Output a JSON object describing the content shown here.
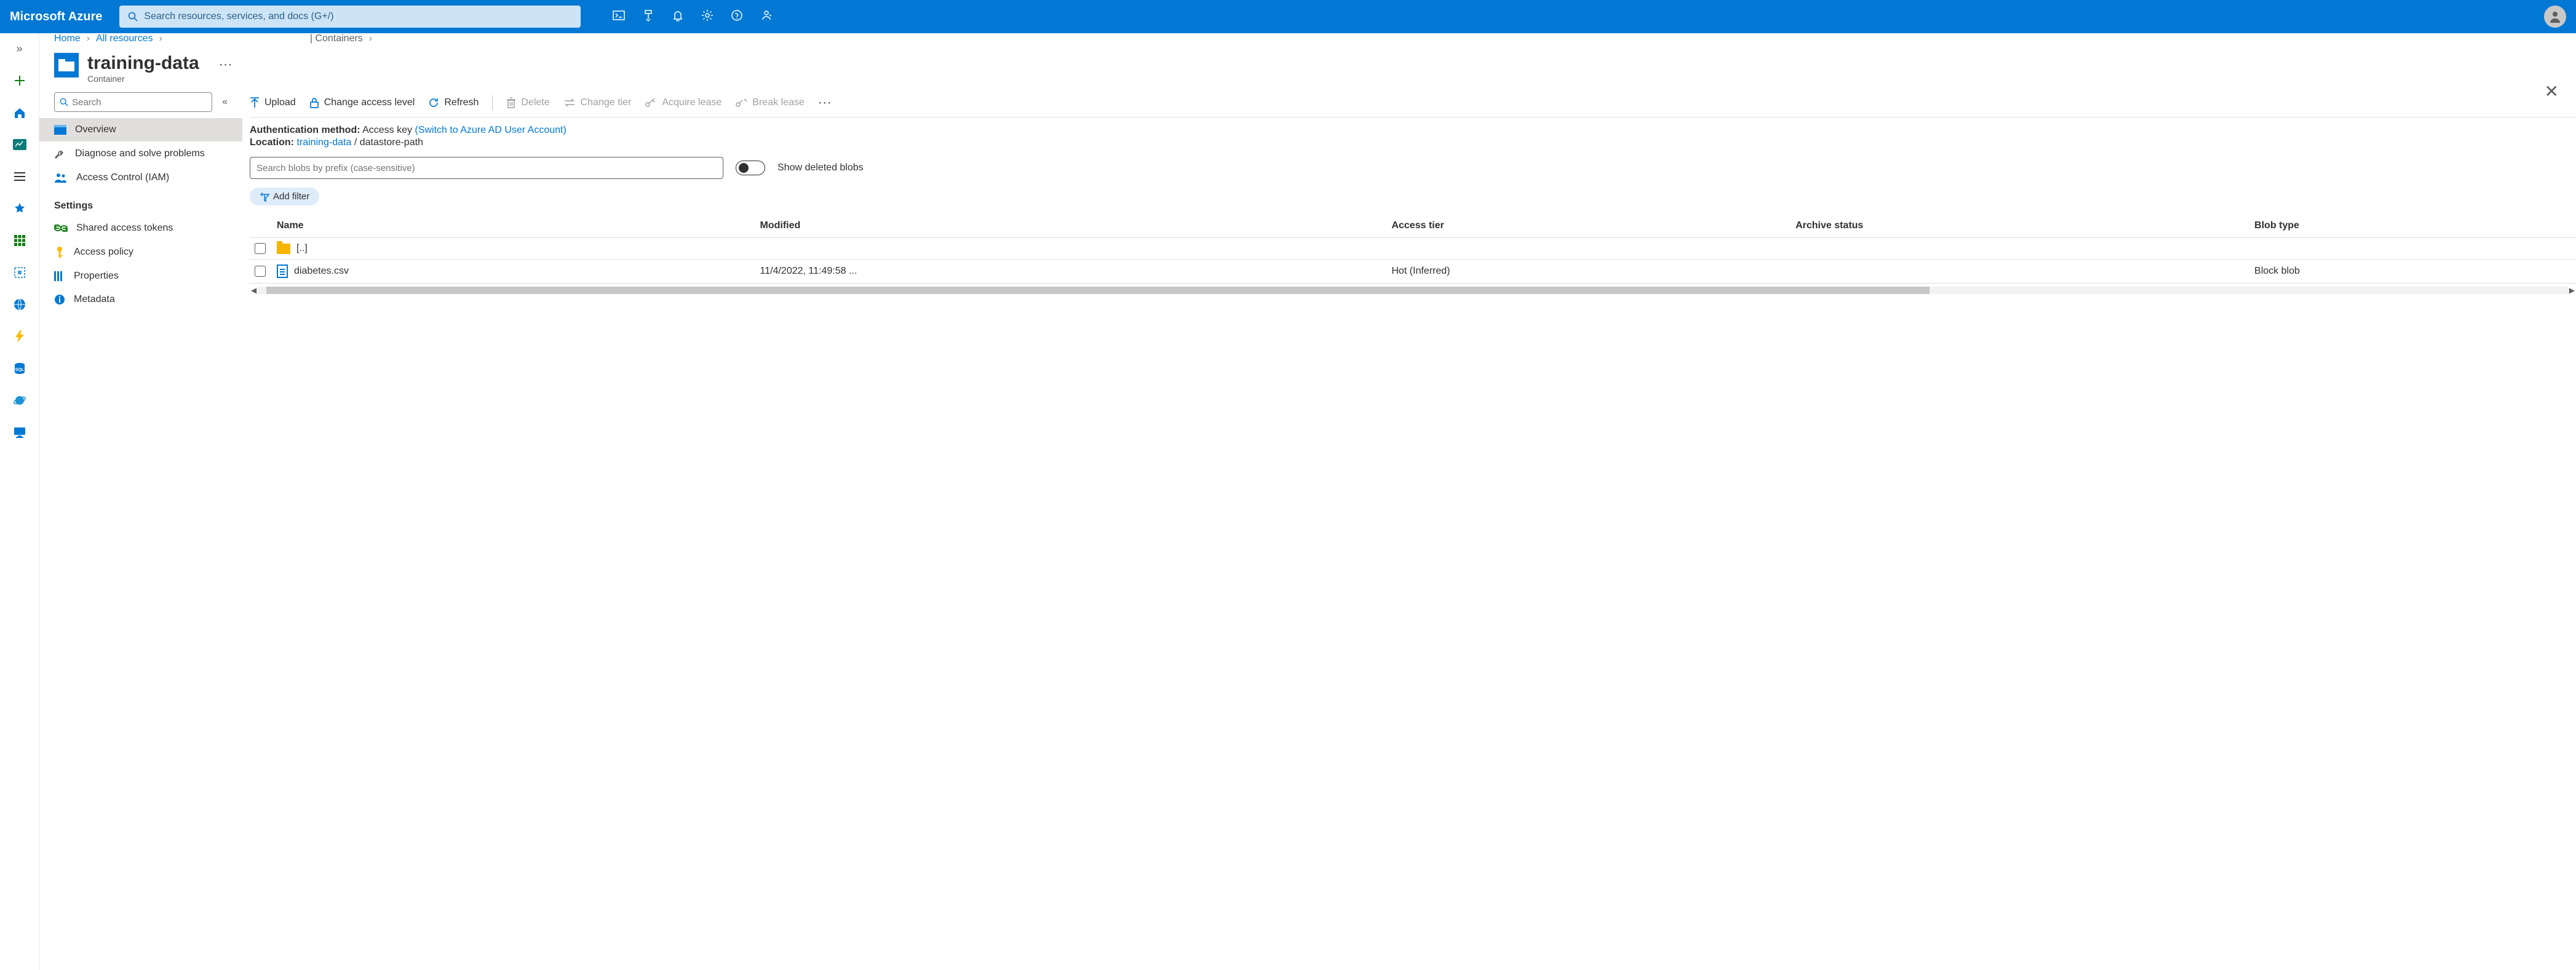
{
  "brand": "Microsoft Azure",
  "topsearch_placeholder": "Search resources, services, and docs (G+/)",
  "breadcrumbs": {
    "home": "Home",
    "all": "All resources",
    "pipe": "| Containers"
  },
  "heading": {
    "title": "training-data",
    "subtitle": "Container"
  },
  "sidesearch_placeholder": "Search",
  "menu": {
    "overview": "Overview",
    "diagnose": "Diagnose and solve problems",
    "iam": "Access Control (IAM)",
    "settings_section": "Settings",
    "sas": "Shared access tokens",
    "policy": "Access policy",
    "props": "Properties",
    "meta": "Metadata"
  },
  "toolbar": {
    "upload": "Upload",
    "cal": "Change access level",
    "refresh": "Refresh",
    "delete": "Delete",
    "tier": "Change tier",
    "acquire": "Acquire lease",
    "break": "Break lease"
  },
  "auth": {
    "method_lbl": "Authentication method:",
    "method_val": "Access key",
    "switch": "(Switch to Azure AD User Account)",
    "loc_lbl": "Location:",
    "loc_link": "training-data",
    "loc_rest": "datastore-path"
  },
  "blobsearch_placeholder": "Search blobs by prefix (case-sensitive)",
  "toggle_label": "Show deleted blobs",
  "add_filter": "Add filter",
  "cols": {
    "name": "Name",
    "mod": "Modified",
    "tier": "Access tier",
    "arch": "Archive status",
    "type": "Blob type"
  },
  "rows": [
    {
      "name": "[..]",
      "kind": "folder",
      "mod": "",
      "tier": "",
      "arch": "",
      "type": ""
    },
    {
      "name": "diabetes.csv",
      "kind": "file",
      "mod": "11/4/2022, 11:49:58 ...",
      "tier": "Hot (Inferred)",
      "arch": "",
      "type": "Block blob"
    }
  ]
}
